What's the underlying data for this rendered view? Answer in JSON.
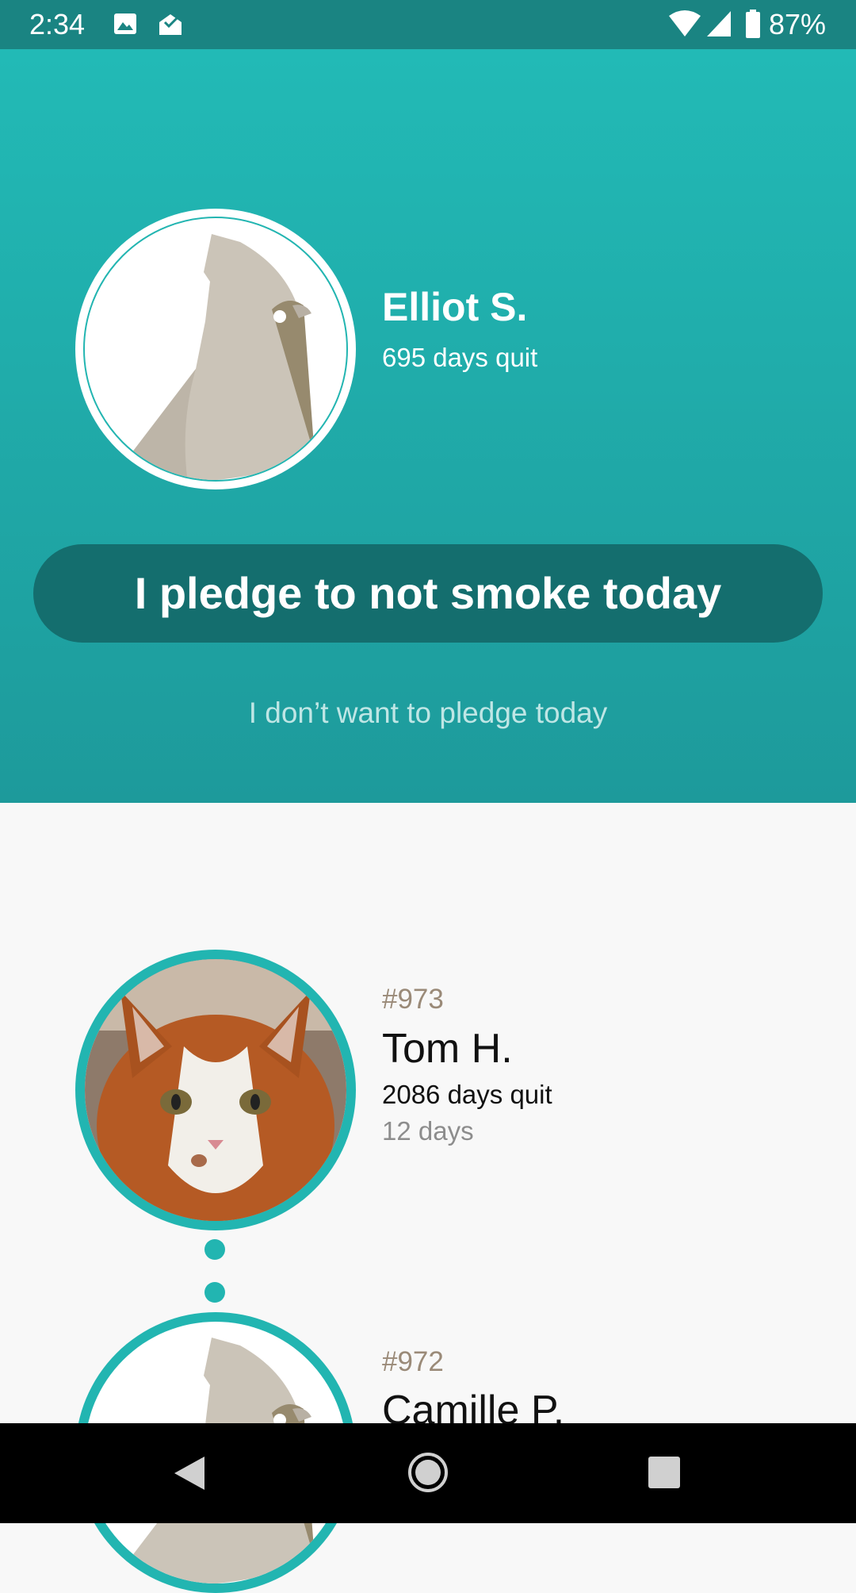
{
  "status_bar": {
    "time": "2:34",
    "battery": "87%",
    "icons": [
      "image-icon",
      "mail-check-icon",
      "wifi-icon",
      "signal-icon",
      "battery-icon"
    ]
  },
  "current_user": {
    "name": "Elliot S.",
    "days_quit": "695 days quit",
    "avatar": "bird-avatar"
  },
  "pledge": {
    "button_label": "I pledge to not smoke today",
    "skip_label": "I don’t want to pledge today"
  },
  "feed": [
    {
      "rank": "#973",
      "name": "Tom H.",
      "days_quit": "2086 days quit",
      "streak": "12 days",
      "avatar": "cat-photo"
    },
    {
      "rank": "#972",
      "name": "Camille P.",
      "avatar": "bird-avatar"
    }
  ],
  "colors": {
    "accent": "#22b5b1",
    "button": "#146e6e",
    "status_bar": "#1a8482"
  }
}
